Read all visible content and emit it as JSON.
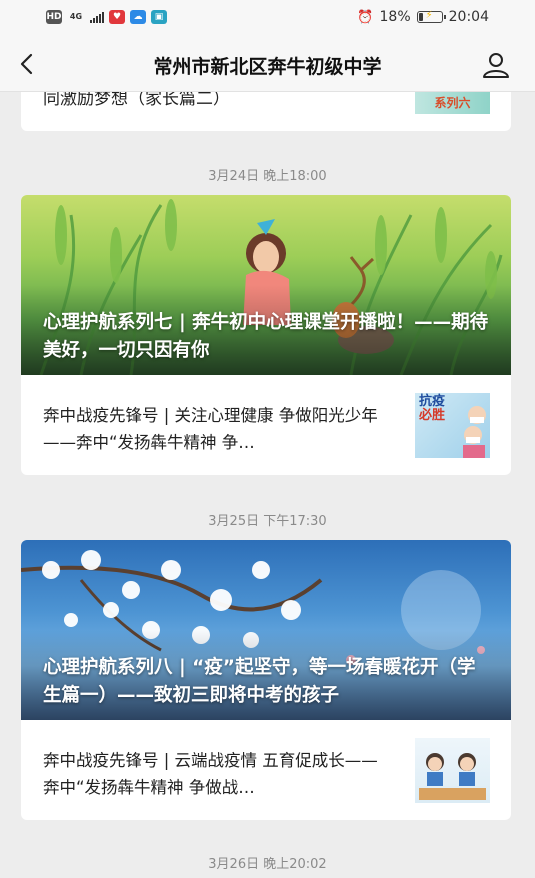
{
  "status_bar": {
    "left_icons": [
      "HD",
      "4G",
      "signal-icon",
      "app-icon-1",
      "cloud-icon",
      "app-icon-3"
    ],
    "network_label": "4G",
    "hd_label": "HD",
    "battery_percent": "18%",
    "battery_level": 0.18,
    "time": "20:04"
  },
  "navbar": {
    "title": "常州市新北区奔牛初级中学",
    "back_icon": "chevron-left-icon",
    "profile_icon": "user-icon"
  },
  "partial_article": {
    "text": "同激励梦想（家长篇二）",
    "thumb_text": "系列六"
  },
  "groups": [
    {
      "time": "3月24日 晚上18:00",
      "headline": "心理护航系列七 | 奔牛初中心理课堂开播啦！——期待美好，一切只因有你",
      "article": {
        "title": "奔中战疫先锋号 | 关注心理健康  争做阳光少年——奔中“发扬犇牛精神 争…",
        "thumb_text_1": "抗疫",
        "thumb_text_2": "必胜"
      }
    },
    {
      "time": "3月25日 下午17:30",
      "headline": "心理护航系列八 | “疫”起坚守，等一场春暖花开（学生篇一）——致初三即将中考的孩子",
      "article": {
        "title": "奔中战疫先锋号 | 云端战疫情  五育促成长——奔中“发扬犇牛精神 争做战…"
      }
    }
  ],
  "next_group_time": "3月26日 晚上20:02",
  "colors": {
    "background": "#ededed",
    "card": "#ffffff",
    "time_text": "#8a8a8a"
  }
}
